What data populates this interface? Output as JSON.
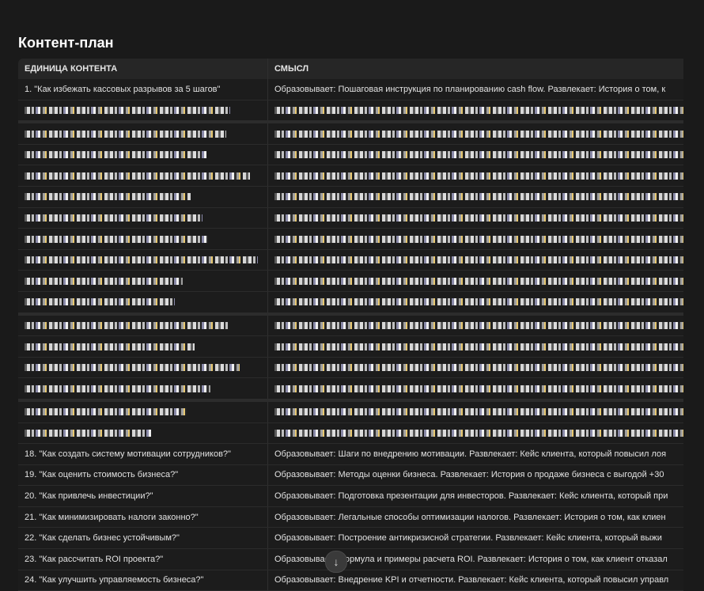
{
  "title": "Контент-план",
  "columns": [
    "ЕДИНИЦА КОНТЕНТА",
    "СМЫСЛ"
  ],
  "rows": [
    {
      "unit": "1. \"Как избежать кассовых разрывов за 5 шагов\"",
      "meaning": "Образовывает: Пошаговая инструкция по планированию cash flow. Развлекает: История о том, к"
    },
    {
      "unit": "18. \"Как создать систему мотивации сотрудников?\"",
      "meaning": "Образовывает: Шаги по внедрению мотивации. Развлекает: Кейс клиента, который повысил лоя"
    },
    {
      "unit": "19. \"Как оценить стоимость бизнеса?\"",
      "meaning": "Образовывает: Методы оценки бизнеса. Развлекает: История о продаже бизнеса с выгодой +30"
    },
    {
      "unit": "20. \"Как привлечь инвестиции?\"",
      "meaning": "Образовывает: Подготовка презентации для инвесторов. Развлекает: Кейс клиента, который при"
    },
    {
      "unit": "21. \"Как минимизировать налоги законно?\"",
      "meaning": "Образовывает: Легальные способы оптимизации налогов. Развлекает: История о том, как клиен"
    },
    {
      "unit": "22. \"Как сделать бизнес устойчивым?\"",
      "meaning": "Образовывает: Построение антикризисной стратегии. Развлекает: Кейс клиента, который выжи"
    },
    {
      "unit": "23. \"Как рассчитать ROI проекта?\"",
      "meaning": "Образовывает: Формула и примеры расчета ROI. Развлекает: История о том, как клиент отказал"
    },
    {
      "unit": "24. \"Как улучшить управляемость бизнеса?\"",
      "meaning": "Образовывает: Внедрение KPI и отчетности. Развлекает: Кейс клиента, который повысил управл"
    }
  ]
}
